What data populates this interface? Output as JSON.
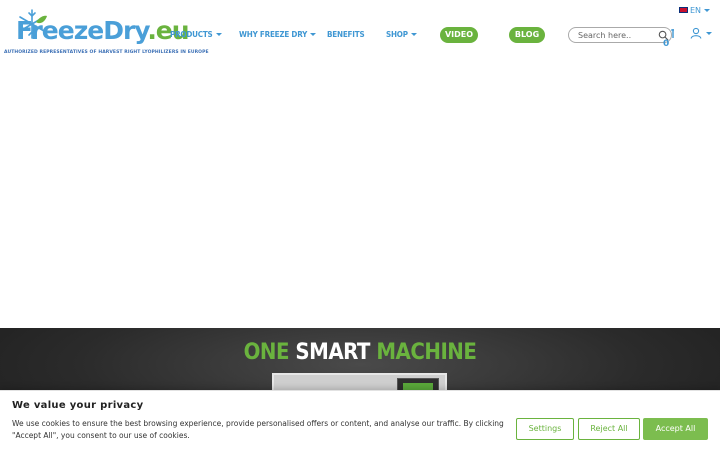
{
  "logo": {
    "word": "FreezeDry",
    "suffix": ".eu",
    "tagline": "AUTHORIZED REPRESENTATIVES OF HARVEST RIGHT LYOPHILIZERS IN EUROPE"
  },
  "nav": {
    "products": "PRODUCTS",
    "why": "WHY FREEZE DRY",
    "benefits": "BENEFITS",
    "shop": "SHOP",
    "video": "VIDEO",
    "blog": "BLOG"
  },
  "search": {
    "placeholder": "Search here.."
  },
  "lang": {
    "code": "EN"
  },
  "cart": {
    "count": "0"
  },
  "banner": {
    "word1": "ONE",
    "word2": "SMART",
    "word3": "MACHINE"
  },
  "cookie": {
    "title": "We value your privacy",
    "text": "We use cookies to ensure the best browsing experience, provide personalised offers or content, and analyse our traffic. By clicking \"Accept All\", you consent to our use of cookies.",
    "settings": "Settings",
    "reject": "Reject All",
    "accept": "Accept All"
  },
  "colors": {
    "brand_blue": "#3f97d3",
    "brand_green": "#6ab33e"
  }
}
